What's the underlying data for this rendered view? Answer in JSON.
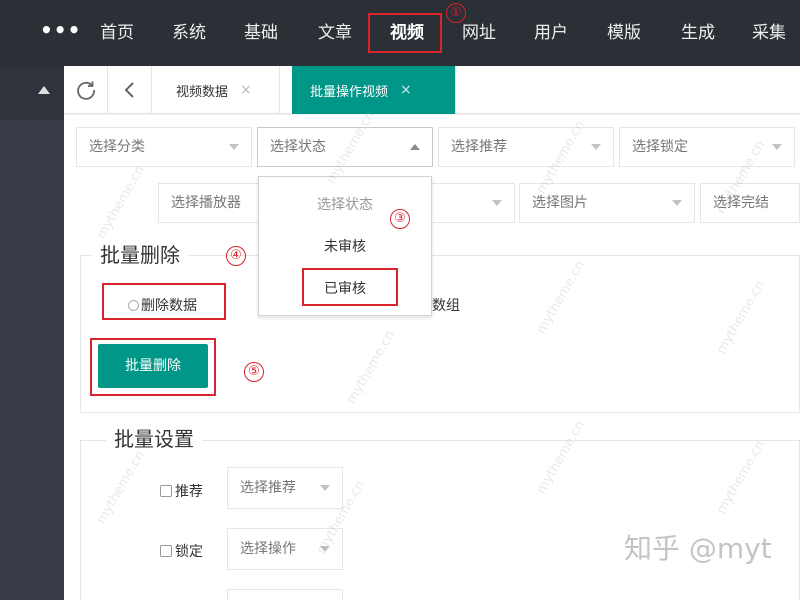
{
  "nav": {
    "more_icon": "more-dots-icon",
    "items": [
      "首页",
      "系统",
      "基础",
      "文章",
      "视频",
      "网址",
      "用户",
      "模版",
      "生成",
      "采集"
    ],
    "active_index": 4
  },
  "tabs": {
    "refresh_icon": "refresh-icon",
    "back_icon": "chevron-left-icon",
    "items": [
      {
        "label": "视频数据",
        "close": "×"
      },
      {
        "label": "批量操作视频",
        "close": "×"
      }
    ],
    "active_index": 1
  },
  "filters": {
    "row1": [
      "选择分类",
      "选择状态",
      "选择推荐",
      "选择锁定"
    ],
    "row2": [
      "选择播放器",
      "选择图片",
      "选择完结"
    ]
  },
  "status_dropdown": {
    "options": [
      "选择状态",
      "未审核",
      "已审核"
    ]
  },
  "batch_delete": {
    "legend": "批量删除",
    "radio_delete_data": "删除数据",
    "radio_partial_text": "数组",
    "button": "批量删除"
  },
  "batch_settings": {
    "legend": "批量设置",
    "rows": [
      {
        "label": "推荐",
        "select": "选择推荐"
      },
      {
        "label": "锁定",
        "select": "选择操作"
      }
    ]
  },
  "annotations": [
    "①",
    "③",
    "④",
    "⑤"
  ],
  "watermark_text": "mytheme.cn",
  "credit": "知乎 @myt",
  "colors": {
    "nav_bg": "#2b2f36",
    "sidebar_bg": "#393d49",
    "accent": "#009688",
    "annotation_red": "#d9232d"
  }
}
